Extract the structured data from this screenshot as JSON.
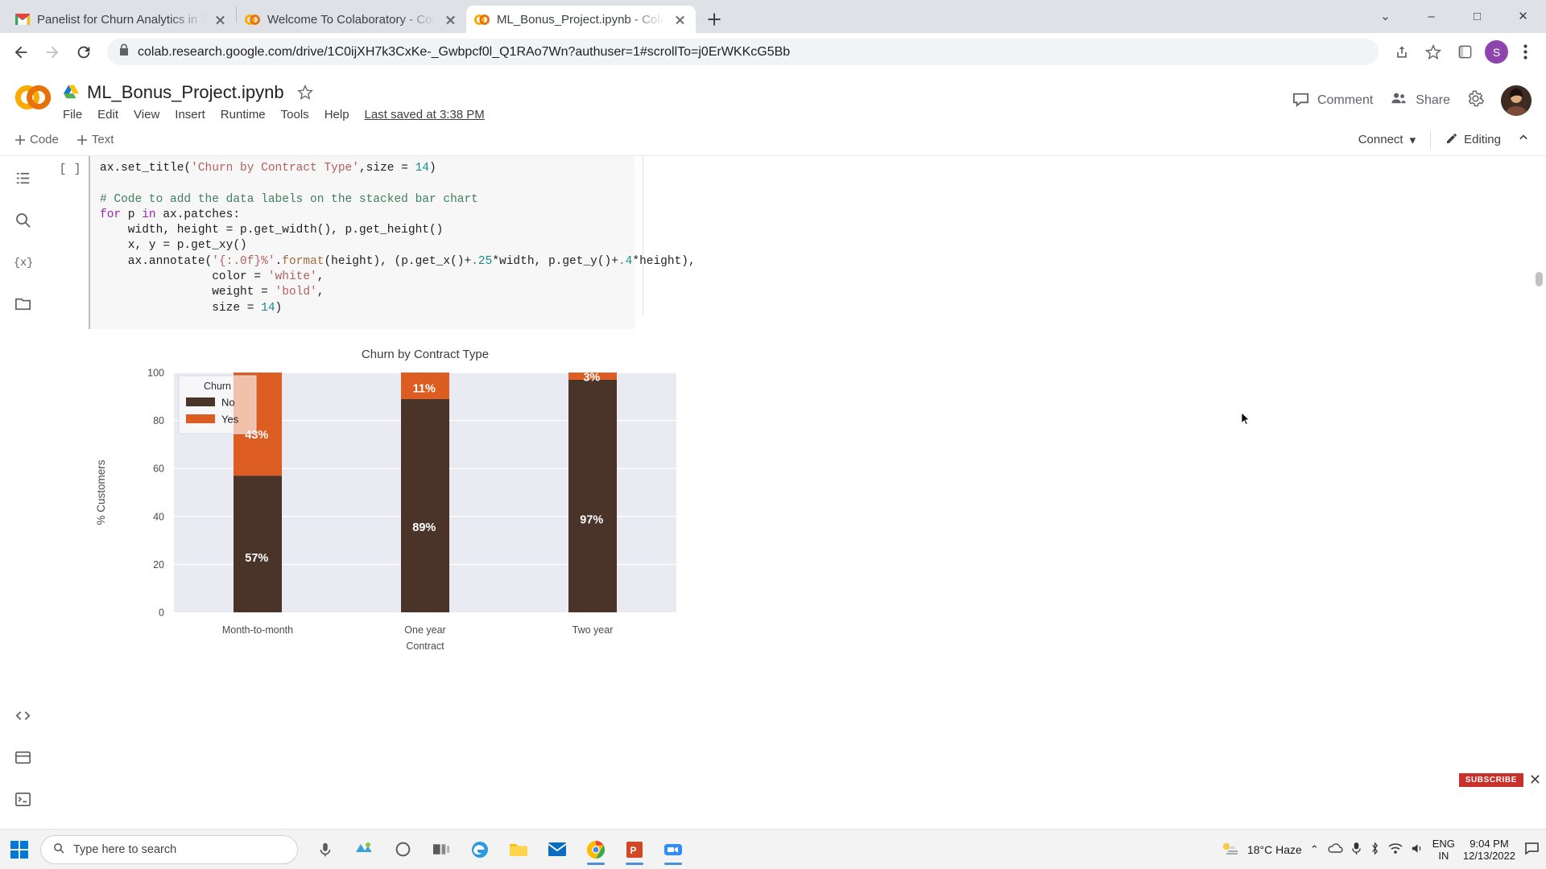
{
  "browser": {
    "tabs": [
      {
        "title": "Panelist for Churn Analytics in Te",
        "favicon": "gmail-icon",
        "active": false
      },
      {
        "title": "Welcome To Colaboratory - Colab",
        "favicon": "colab-icon",
        "active": false
      },
      {
        "title": "ML_Bonus_Project.ipynb - Colab",
        "favicon": "colab-icon",
        "active": true
      }
    ],
    "newtab_label": "+",
    "window_controls": {
      "minimize": "–",
      "maximize": "□",
      "close": "✕",
      "tablist": "⌄"
    },
    "nav": {
      "back": "back-arrow-icon",
      "forward": "forward-arrow-icon",
      "reload": "reload-icon"
    },
    "omnibox": {
      "lock": "lock-icon",
      "url": "colab.research.google.com/drive/1C0ijXH7k3CxKe-_Gwbpcf0l_Q1RAo7Wn?authuser=1#scrollTo=j0ErWKKcG5Bb",
      "share_icon": "share-icon",
      "bookmark_icon": "star-icon",
      "extensions_icon": "extensions-icon"
    },
    "profile_initial": "S",
    "menu_icon": "kebab-menu-icon"
  },
  "colab": {
    "logo": "colab-logo",
    "drive_icon": "google-drive-icon",
    "notebook_title": "ML_Bonus_Project.ipynb",
    "star": "star-outline-icon",
    "menu": [
      "File",
      "Edit",
      "View",
      "Insert",
      "Runtime",
      "Tools",
      "Help"
    ],
    "last_saved": "Last saved at 3:38 PM",
    "header_actions": {
      "comment": "Comment",
      "comment_icon": "comment-icon",
      "share": "Share",
      "share_icon": "people-icon",
      "settings_icon": "gear-icon",
      "avatar": "user-avatar"
    },
    "cellbar": {
      "add_code": "Code",
      "add_text": "Text",
      "connect": "Connect",
      "connect_caret": "▾",
      "editing": "Editing",
      "editing_icon": "pencil-icon",
      "collapse_icon": "chevron-up-icon"
    },
    "rail_icons": [
      "toc-icon",
      "search-icon",
      "variables-icon",
      "files-icon"
    ],
    "rail_bottom_icons": [
      "code-snippets-icon",
      "terminal-panel-icon",
      "terminal-icon"
    ],
    "cell": {
      "prompt": "[ ]",
      "code_lines": [
        [
          {
            "t": "ax.set_title(",
            "c": ""
          },
          {
            "t": "'Churn by Contract Type'",
            "c": "tok-str"
          },
          {
            "t": ",size = ",
            "c": ""
          },
          {
            "t": "14",
            "c": "tok-num"
          },
          {
            "t": ")",
            "c": ""
          }
        ],
        [
          {
            "t": "",
            "c": ""
          }
        ],
        [
          {
            "t": "# Code to add the data labels on the stacked bar chart",
            "c": "tok-com"
          }
        ],
        [
          {
            "t": "for",
            "c": "tok-kw"
          },
          {
            "t": " p ",
            "c": ""
          },
          {
            "t": "in",
            "c": "tok-kw"
          },
          {
            "t": " ax.patches:",
            "c": ""
          }
        ],
        [
          {
            "t": "    width, height = p.get_width(), p.get_height()",
            "c": ""
          }
        ],
        [
          {
            "t": "    x, y = p.get_xy()",
            "c": ""
          }
        ],
        [
          {
            "t": "    ax.annotate(",
            "c": ""
          },
          {
            "t": "'{:.0f}%'",
            "c": "tok-str"
          },
          {
            "t": ".",
            "c": ""
          },
          {
            "t": "format",
            "c": "tok-fn"
          },
          {
            "t": "(height), (p.get_x()+",
            "c": ""
          },
          {
            "t": ".25",
            "c": "tok-num"
          },
          {
            "t": "*width, p.get_y()+",
            "c": ""
          },
          {
            "t": ".4",
            "c": "tok-num"
          },
          {
            "t": "*height),",
            "c": ""
          }
        ],
        [
          {
            "t": "                color = ",
            "c": ""
          },
          {
            "t": "'white'",
            "c": "tok-str"
          },
          {
            "t": ",",
            "c": ""
          }
        ],
        [
          {
            "t": "                weight = ",
            "c": ""
          },
          {
            "t": "'bold'",
            "c": "tok-str"
          },
          {
            "t": ",",
            "c": ""
          }
        ],
        [
          {
            "t": "                size = ",
            "c": ""
          },
          {
            "t": "14",
            "c": "tok-num"
          },
          {
            "t": ")",
            "c": ""
          }
        ]
      ]
    }
  },
  "chart_data": {
    "type": "bar",
    "subtype": "stacked-bar",
    "title": "Churn by Contract Type",
    "xlabel": "Contract",
    "ylabel": "% Customers",
    "categories": [
      "Month-to-month",
      "One year",
      "Two year"
    ],
    "yticks": [
      0,
      20,
      40,
      60,
      80,
      100
    ],
    "ylim": [
      0,
      100
    ],
    "grid": true,
    "legend": {
      "title": "Churn",
      "position": "upper left",
      "entries": [
        {
          "label": "No",
          "color": "#4a342a"
        },
        {
          "label": "Yes",
          "color": "#dd5c22"
        }
      ]
    },
    "series": [
      {
        "name": "No",
        "color": "#4a342a",
        "values": [
          57,
          89,
          97
        ],
        "labels": [
          "57%",
          "89%",
          "97%"
        ]
      },
      {
        "name": "Yes",
        "color": "#dd5c22",
        "values": [
          43,
          11,
          3
        ],
        "labels": [
          "43%",
          "11%",
          "3%"
        ]
      }
    ],
    "plot_bg": "#eaeaf2",
    "grid_color": "#ffffff"
  },
  "taskbar": {
    "start_icon": "windows-start-icon",
    "search_icon": "search-icon",
    "search_placeholder": "Type here to search",
    "icons": [
      "mic-icon",
      "app-teams-icon",
      "cortana-icon",
      "task-view-icon",
      "edge-icon",
      "file-explorer-icon",
      "mail-icon",
      "chrome-icon",
      "powerpoint-icon",
      "zoom-icon"
    ],
    "tray": {
      "weather_icon": "haze-icon",
      "weather": "18°C  Haze",
      "chevron": "⌃",
      "lang_line1": "ENG",
      "lang_line2": "IN",
      "time": "9:04 PM",
      "date": "12/13/2022",
      "notification_icon": "notification-icon"
    }
  },
  "overlay": {
    "subscribe": "SUBSCRIBE",
    "close": "✕"
  }
}
